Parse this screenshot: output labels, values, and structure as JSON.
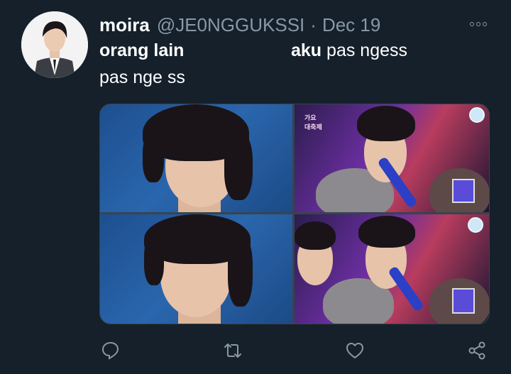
{
  "tweet": {
    "display_name": "moira",
    "handle": "@JE0NGGUKSSI",
    "separator": "·",
    "date": "Dec 19",
    "text_left": "orang lain",
    "text_right_bold": "aku",
    "text_right_rest": " pas ngess",
    "text_line2": "pas nge ss"
  },
  "media": {
    "panel_1": "portrait-blue-background",
    "panel_2": "stage-microphone",
    "panel_3": "portrait-blue-background",
    "panel_4": "stage-microphone"
  },
  "icons": {
    "more": "more-icon",
    "reply": "reply-icon",
    "retweet": "retweet-icon",
    "like": "like-icon",
    "share": "share-icon"
  },
  "colors": {
    "background": "#15202b",
    "secondary_text": "#8899a6",
    "primary_text": "#ffffff"
  }
}
